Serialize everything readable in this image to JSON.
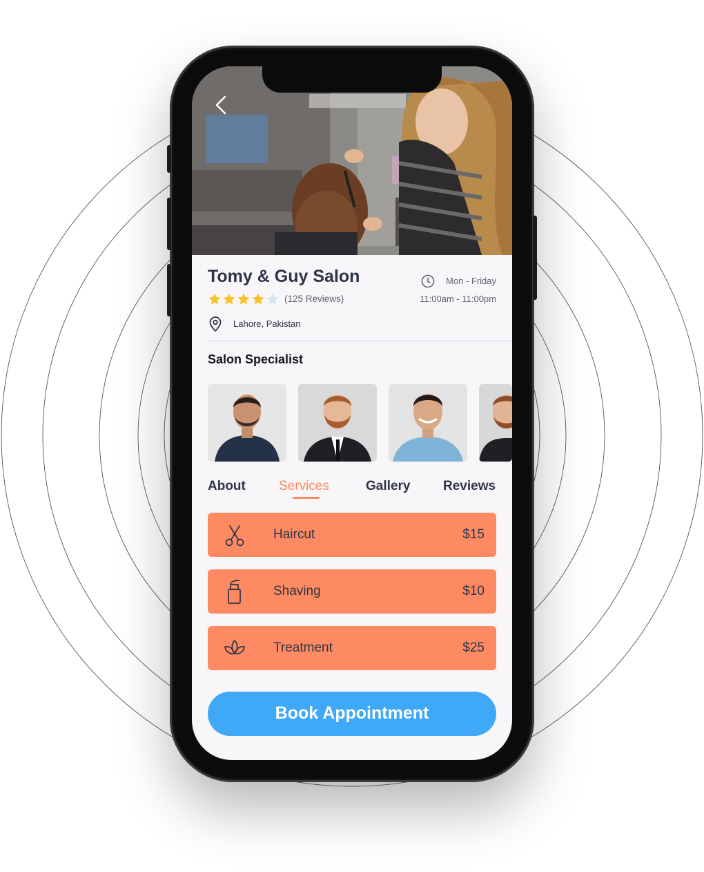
{
  "salon": {
    "name": "Tomy & Guy Salon",
    "rating": 4,
    "rating_max": 5,
    "reviews": "(125 Reviews)",
    "days": "Mon - Friday",
    "hours": "11:00am - 11:00pm",
    "location": "Lahore, Pakistan"
  },
  "specialists": {
    "title": "Salon Specialist"
  },
  "tabs": [
    {
      "label": "About"
    },
    {
      "label": "Services"
    },
    {
      "label": "Gallery"
    },
    {
      "label": "Reviews"
    }
  ],
  "active_tab": "Services",
  "services": [
    {
      "label": "Haircut",
      "price": "$15",
      "icon": "scissors-icon"
    },
    {
      "label": "Shaving",
      "price": "$10",
      "icon": "spray-bottle-icon"
    },
    {
      "label": "Treatment",
      "price": "$25",
      "icon": "lotus-icon"
    }
  ],
  "book_button": {
    "label": "Book Appointment"
  },
  "colors": {
    "accent": "#fd8a62",
    "primary_button": "#3fa8f7",
    "star": "#f7c325",
    "text_dark": "#2d3447"
  }
}
